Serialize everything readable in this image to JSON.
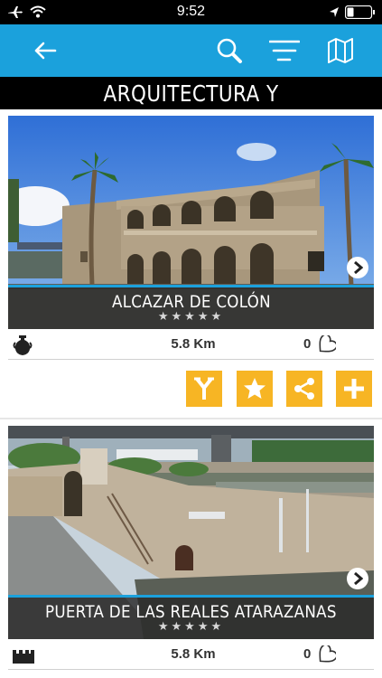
{
  "status_bar": {
    "time": "9:52",
    "icons": [
      "airplane-icon",
      "wifi-icon",
      "location-arrow-icon",
      "battery-icon"
    ]
  },
  "nav": {
    "icons": [
      "back-arrow-icon",
      "search-icon",
      "sort-filter-icon",
      "map-icon"
    ]
  },
  "section_title": "ARQUITECTURA Y MONUMENTOS",
  "cards": [
    {
      "name": "ALCAZAR DE COLÓN",
      "stars": "★★★★★",
      "rating": 5,
      "distance": "5.8 Km",
      "likes": "0",
      "category_icon": "amphora-icon",
      "actions": [
        "route-icon",
        "star-icon",
        "share-icon",
        "plus-icon"
      ]
    },
    {
      "name": "PUERTA DE LAS REALES ATARAZANAS",
      "stars": "★★★★★",
      "rating": 5,
      "distance": "5.8 Km",
      "likes": "0",
      "category_icon": "castle-icon"
    }
  ],
  "colors": {
    "nav_blue": "#1ba1dc",
    "action_orange": "#f7b524",
    "title_bg": "#000000"
  }
}
